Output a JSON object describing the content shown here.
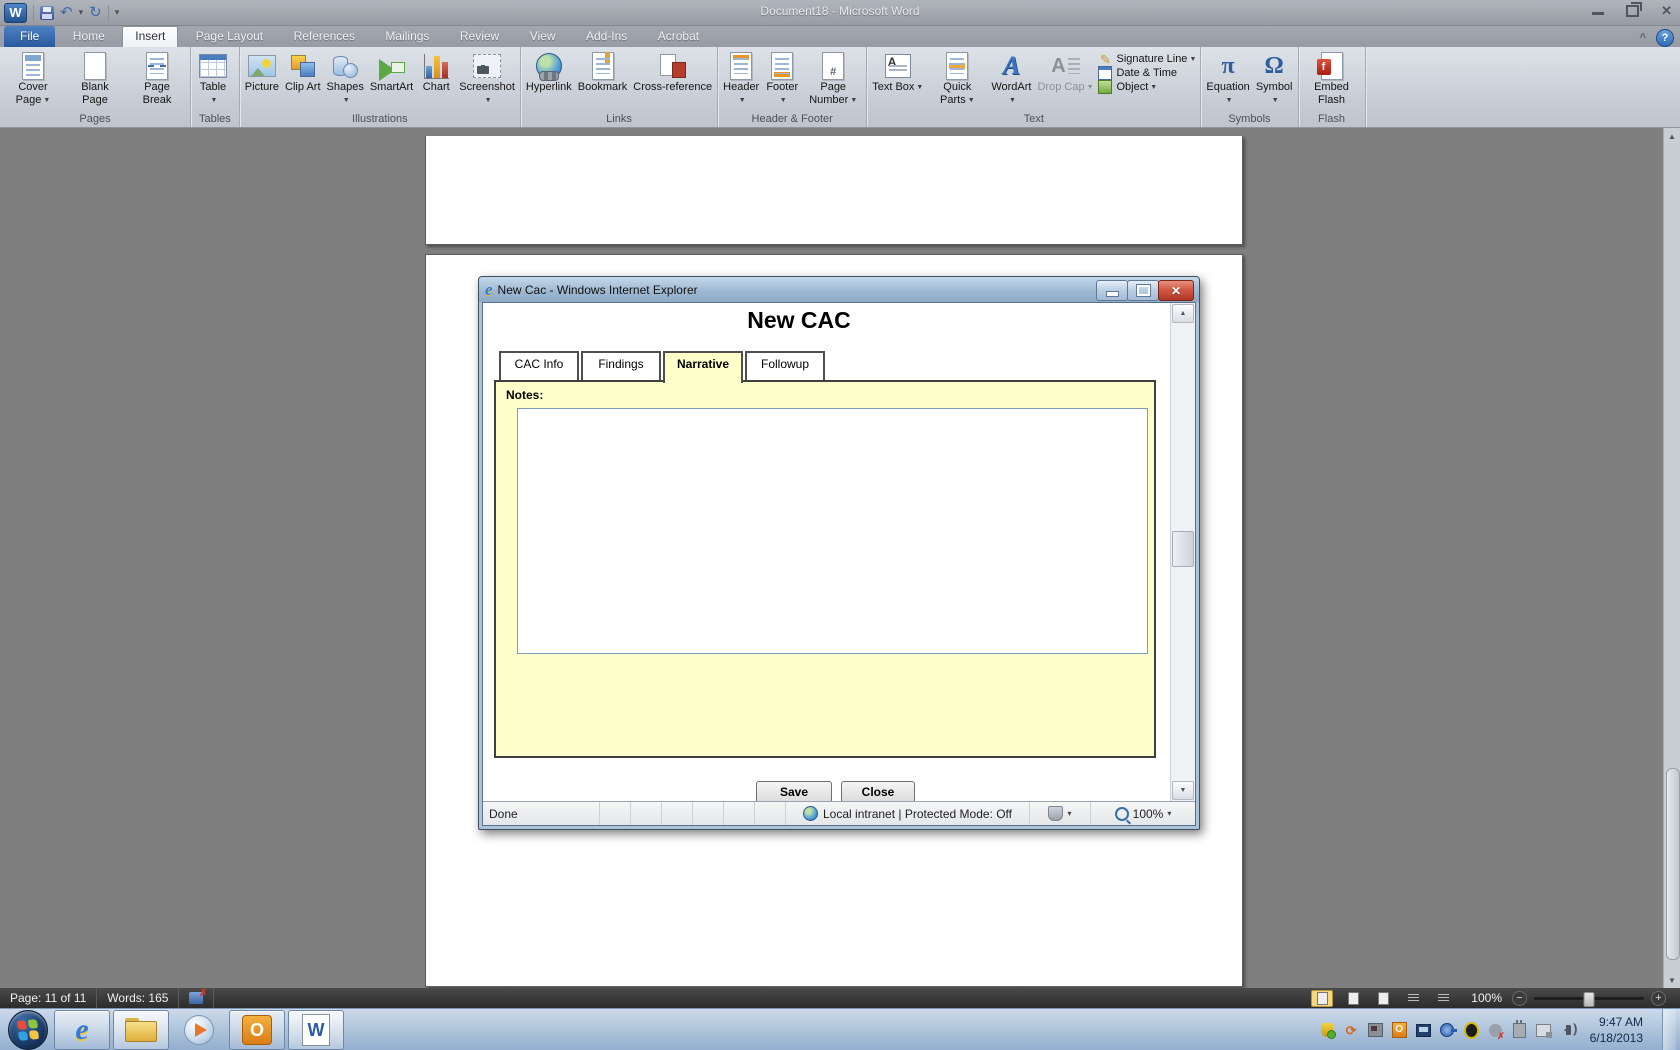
{
  "word": {
    "title": "Document18  -  Microsoft Word",
    "tabs": [
      "File",
      "Home",
      "Insert",
      "Page Layout",
      "References",
      "Mailings",
      "Review",
      "View",
      "Add-Ins",
      "Acrobat"
    ],
    "active_tab": "Insert",
    "ribbon": {
      "groups": [
        {
          "name": "Pages",
          "buttons": [
            "Cover Page",
            "Blank Page",
            "Page Break"
          ]
        },
        {
          "name": "Tables",
          "buttons": [
            "Table"
          ]
        },
        {
          "name": "Illustrations",
          "buttons": [
            "Picture",
            "Clip Art",
            "Shapes",
            "SmartArt",
            "Chart",
            "Screenshot"
          ]
        },
        {
          "name": "Links",
          "buttons": [
            "Hyperlink",
            "Bookmark",
            "Cross-reference"
          ]
        },
        {
          "name": "Header & Footer",
          "buttons": [
            "Header",
            "Footer",
            "Page Number"
          ]
        },
        {
          "name": "Text",
          "buttons": [
            "Text Box",
            "Quick Parts",
            "WordArt",
            "Drop Cap"
          ],
          "small": [
            "Signature Line",
            "Date & Time",
            "Object"
          ]
        },
        {
          "name": "Symbols",
          "buttons": [
            "Equation",
            "Symbol"
          ]
        },
        {
          "name": "Flash",
          "buttons": [
            "Embed Flash"
          ]
        }
      ]
    },
    "status": {
      "page": "Page: 11 of 11",
      "words": "Words: 165",
      "zoom": "100%"
    }
  },
  "ie": {
    "title": "New Cac - Windows Internet Explorer",
    "heading": "New CAC",
    "tabs": [
      "CAC Info",
      "Findings",
      "Narrative",
      "Followup"
    ],
    "active_tab": "Narrative",
    "notes_label": "Notes:",
    "notes_value": "",
    "save_label": "Save",
    "close_label": "Close",
    "status": {
      "done": "Done",
      "zone": "Local intranet | Protected Mode: Off",
      "zoom": "100%"
    }
  },
  "taskbar": {
    "clock_time": "9:47 AM",
    "clock_date": "6/18/2013"
  },
  "icons": {
    "dropdown": "▼",
    "qat_dropdown": "▾",
    "chevron_up": "^",
    "help": "?",
    "close_x": "✕",
    "up_arrow": "▲",
    "down_arrow": "▼",
    "pi": "π",
    "omega": "Ω",
    "undo": "↶",
    "redo": "↻",
    "minus": "−",
    "plus": "+"
  },
  "colors": {
    "file_tab_blue": "#2a5a9d",
    "ie_titlebar": "#9db7d0",
    "panel_yellow": "#ffffcc",
    "close_red": "#b23726",
    "taskbar_blue": "#a8bfd7",
    "status_dark": "#2c2c2c"
  }
}
